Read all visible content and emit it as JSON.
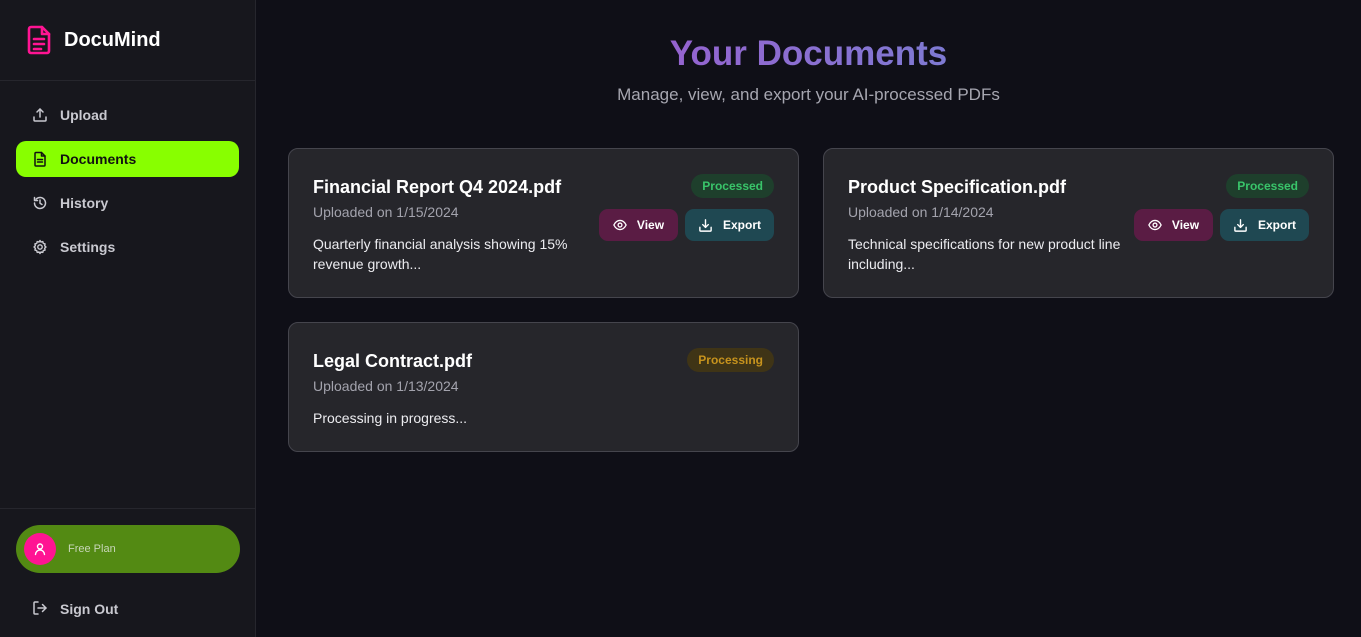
{
  "brand": {
    "name": "DocuMind",
    "icon": "document-icon",
    "color": "#ff1493"
  },
  "nav": [
    {
      "label": "Upload",
      "icon": "upload-icon",
      "active": false
    },
    {
      "label": "Documents",
      "icon": "document-icon",
      "active": true
    },
    {
      "label": "History",
      "icon": "history-icon",
      "active": false
    },
    {
      "label": "Settings",
      "icon": "gear-icon",
      "active": false
    }
  ],
  "account": {
    "plan_label": "Free Plan",
    "avatar_icon": "user-icon"
  },
  "signout_label": "Sign Out",
  "header": {
    "title": "Your Documents",
    "subtitle": "Manage, view, and export your AI-processed PDFs"
  },
  "documents": [
    {
      "title": "Financial Report Q4 2024.pdf",
      "date": "Uploaded on 1/15/2024",
      "description": "Quarterly financial analysis showing 15% revenue growth...",
      "status": "Processed",
      "view_label": "View",
      "export_label": "Export"
    },
    {
      "title": "Product Specification.pdf",
      "date": "Uploaded on 1/14/2024",
      "description": "Technical specifications for new product line including...",
      "status": "Processed",
      "view_label": "View",
      "export_label": "Export"
    },
    {
      "title": "Legal Contract.pdf",
      "date": "Uploaded on 1/13/2024",
      "description": "Processing in progress...",
      "status": "Processing"
    }
  ],
  "colors": {
    "accent": "#88ff00",
    "brand": "#ff1493",
    "status_processed": "#39c46a",
    "status_processing": "#c7931d"
  }
}
